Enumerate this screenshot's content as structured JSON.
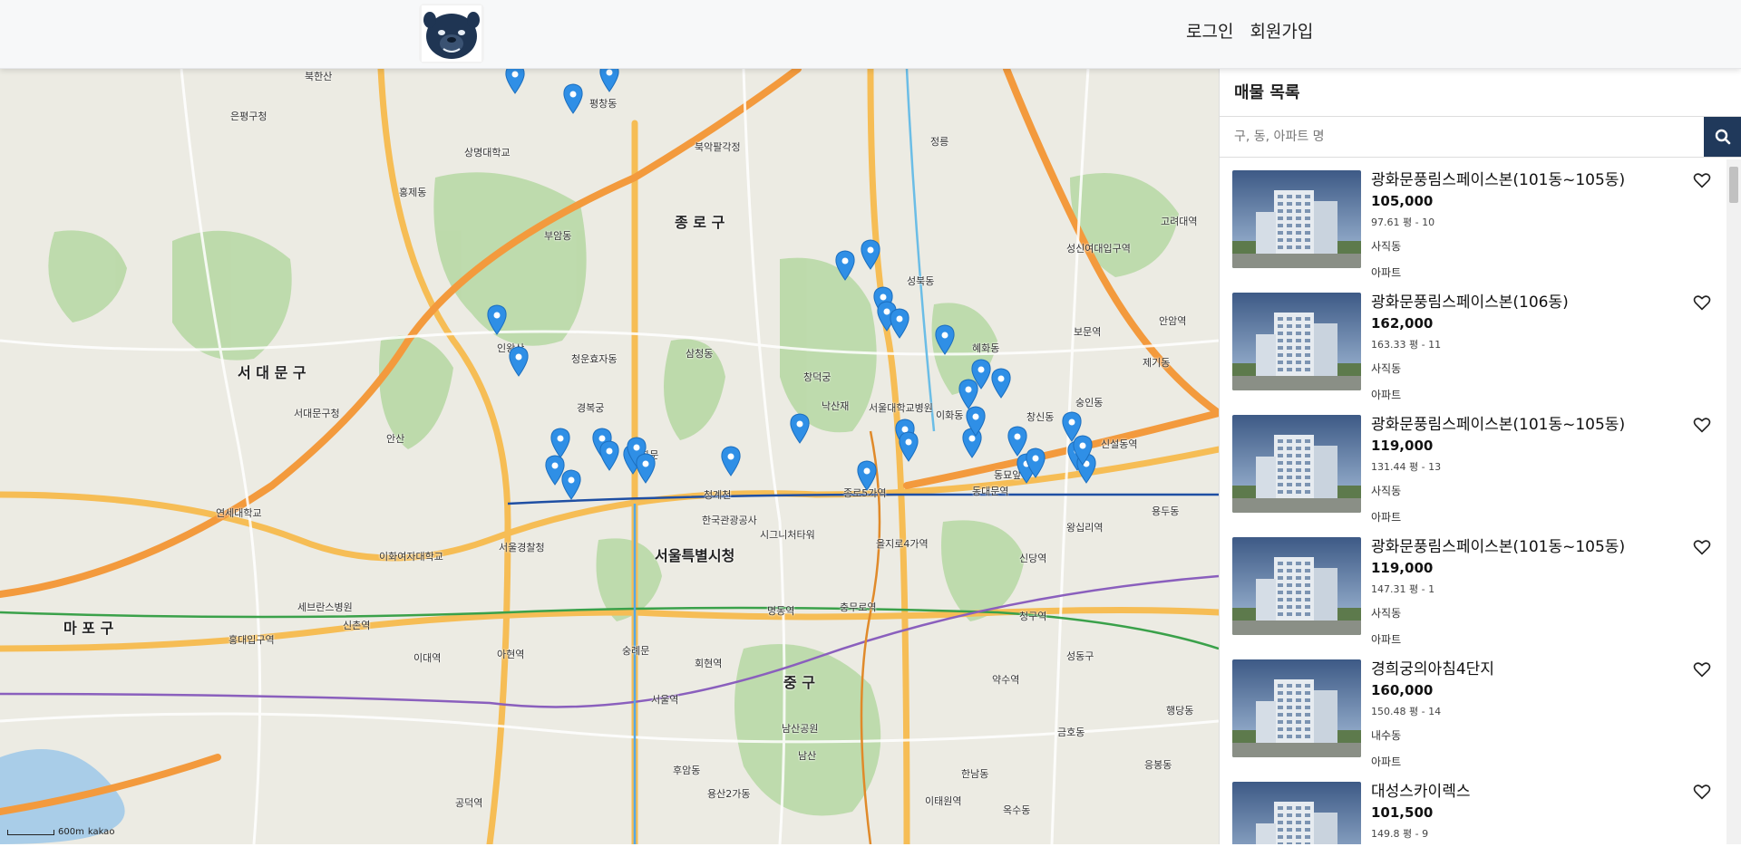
{
  "header": {
    "logo_icon": "bulldog-logo-icon",
    "login": "로그인",
    "signup": "회원가입"
  },
  "map": {
    "attribution": "kakao",
    "scale": "600m",
    "labels": [
      "서울특별시청",
      "종 로 구",
      "서대문구청",
      "서 대 문 구",
      "마 포 구",
      "중 구",
      "은평구청",
      "경복궁",
      "창덕궁",
      "낙산재",
      "서울대학교병원",
      "이화동",
      "북악팔각정",
      "인왕산",
      "안산",
      "홍제동",
      "부암동",
      "청운효자동",
      "삼청동",
      "혜화동",
      "성북동",
      "동대문역",
      "종로5가역",
      "을지로4가역",
      "충무로역",
      "서울역",
      "공덕역",
      "아현역",
      "이대역",
      "신촌역",
      "홍대입구역",
      "숭례문",
      "남산",
      "회현역",
      "명동역",
      "한국관광공사",
      "시그니처타워",
      "광화문",
      "청계천",
      "평창동",
      "상명대학교",
      "북한산",
      "정릉",
      "성신여대입구역",
      "보문역",
      "신설동역",
      "왕십리역",
      "청구역",
      "약수역",
      "신당역",
      "동묘앞역",
      "창신동",
      "숭인동",
      "이화여자대학교",
      "연세대학교",
      "세브란스병원",
      "서울경찰청",
      "남산공원",
      "후암동",
      "용산2가동",
      "이태원역",
      "한남동",
      "금호동",
      "옥수동",
      "성동구",
      "응봉동",
      "행당동",
      "용두동",
      "제기동",
      "안암역",
      "고려대역"
    ]
  },
  "panel": {
    "title": "매물 목록",
    "search_placeholder": "구, 동, 아파트 명",
    "search_icon": "search-icon",
    "listings": [
      {
        "name": "광화문풍림스페이스본(101동~105동)",
        "price": "105,000",
        "area": "97.61 평 - 10",
        "dong": "사직동",
        "type": "아파트"
      },
      {
        "name": "광화문풍림스페이스본(106동)",
        "price": "162,000",
        "area": "163.33 평 - 11",
        "dong": "사직동",
        "type": "아파트"
      },
      {
        "name": "광화문풍림스페이스본(101동~105동)",
        "price": "119,000",
        "area": "131.44 평 - 13",
        "dong": "사직동",
        "type": "아파트"
      },
      {
        "name": "광화문풍림스페이스본(101동~105동)",
        "price": "119,000",
        "area": "147.31 평 - 1",
        "dong": "사직동",
        "type": "아파트"
      },
      {
        "name": "경희궁의아침4단지",
        "price": "160,000",
        "area": "150.48 평 - 14",
        "dong": "내수동",
        "type": "아파트"
      },
      {
        "name": "대성스카이렉스",
        "price": "101,500",
        "area": "149.8 평 - 9",
        "dong": "",
        "type": ""
      }
    ]
  },
  "colors": {
    "accent": "#20395b",
    "marker": "#2f8fe6",
    "road_major": "#f6b64a",
    "road_highway": "#f39a3d",
    "park": "#b6d9a3",
    "river": "#a9cde8"
  }
}
